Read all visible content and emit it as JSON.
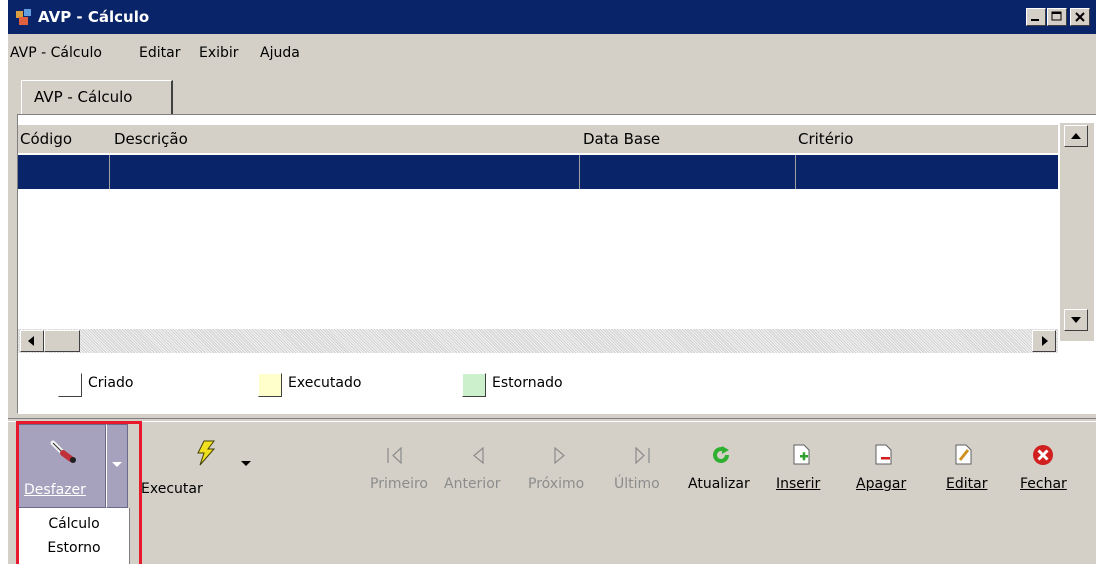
{
  "window": {
    "title": "AVP - Cálculo",
    "controls": [
      "minimize",
      "maximize",
      "close"
    ]
  },
  "menubar": {
    "items": [
      "AVP - Cálculo",
      "Editar",
      "Exibir",
      "Ajuda"
    ]
  },
  "tab": {
    "label": "AVP - Cálculo"
  },
  "grid": {
    "columns": [
      "Código",
      "Descrição",
      "Data Base",
      "Critério"
    ],
    "rows": [
      {
        "codigo": "",
        "descricao": "",
        "data_base": "",
        "criterio": "",
        "selected": true
      }
    ]
  },
  "legend": [
    {
      "label": "Criado",
      "color": "#ffffff"
    },
    {
      "label": "Executado",
      "color": "#ffffcc"
    },
    {
      "label": "Estornado",
      "color": "#ccf0cc"
    }
  ],
  "toolbar": {
    "desfazer": "Desfazer",
    "executar": "Executar",
    "primeiro": "Primeiro",
    "anterior": "Anterior",
    "proximo": "Próximo",
    "ultimo": "Último",
    "atualizar": "Atualizar",
    "inserir": "Inserir",
    "apagar": "Apagar",
    "editar": "Editar",
    "fechar": "Fechar"
  },
  "dropdown": {
    "items": [
      "Cálculo",
      "Estorno"
    ]
  },
  "colors": {
    "titlebar": "#0a246a",
    "highlight": "#e8192c",
    "selected_row": "#0a246a"
  }
}
